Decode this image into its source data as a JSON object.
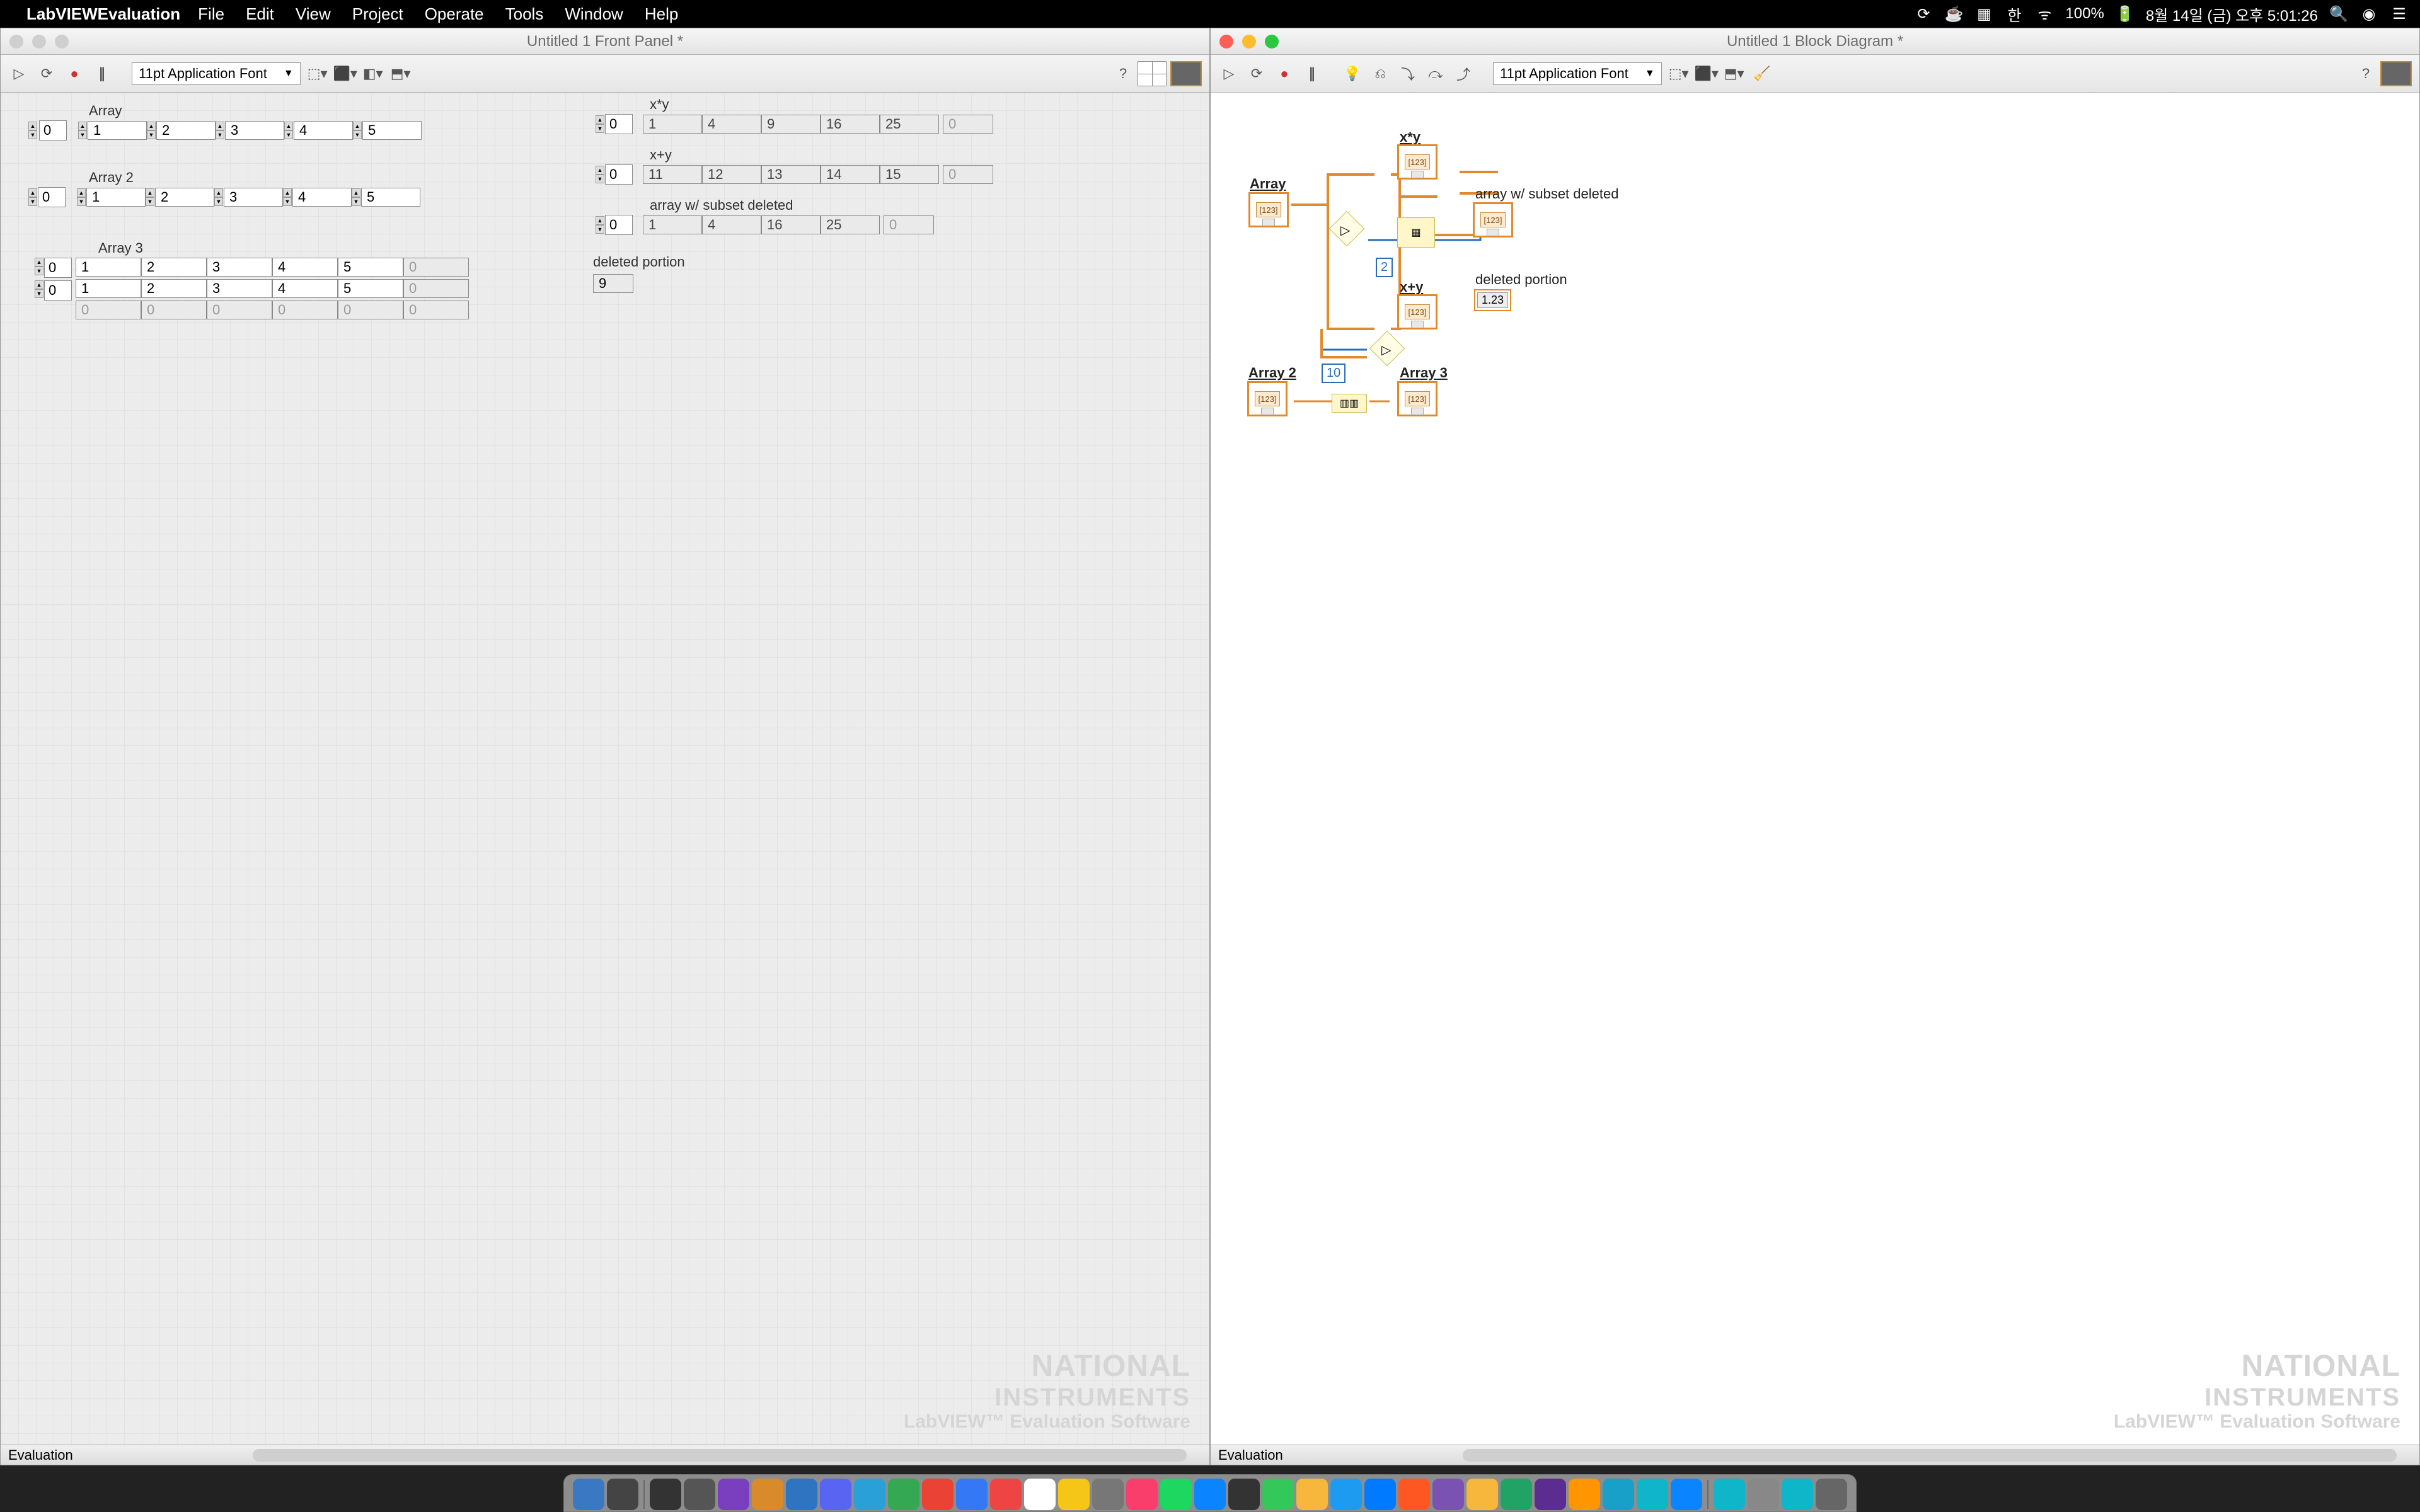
{
  "menubar": {
    "app": "LabVIEWEvaluation",
    "items": [
      "File",
      "Edit",
      "View",
      "Project",
      "Operate",
      "Tools",
      "Window",
      "Help"
    ],
    "status": {
      "battery": "100%",
      "date": "8월 14일 (금)  오후  5:01:26",
      "ime": "한"
    }
  },
  "windows": {
    "front_panel": {
      "title": "Untitled 1 Front Panel *",
      "font": "11pt Application Font",
      "status": "Evaluation"
    },
    "block_diagram": {
      "title": "Untitled 1 Block Diagram *",
      "font": "11pt Application Font",
      "status": "Evaluation"
    }
  },
  "front_panel": {
    "arrays": {
      "Array": {
        "label": "Array",
        "index": "0",
        "row": [
          "1",
          "2",
          "3",
          "4",
          "5"
        ]
      },
      "Array2": {
        "label": "Array 2",
        "index": "0",
        "row": [
          "1",
          "2",
          "3",
          "4",
          "5"
        ]
      },
      "Array3": {
        "label": "Array 3",
        "idx_r": "0",
        "idx_c": "0",
        "rows": [
          [
            "1",
            "2",
            "3",
            "4",
            "5",
            "0"
          ],
          [
            "1",
            "2",
            "3",
            "4",
            "5",
            "0"
          ],
          [
            "0",
            "0",
            "0",
            "0",
            "0",
            "0"
          ]
        ]
      }
    },
    "indicators": {
      "xtimesy": {
        "label": "x*y",
        "index": "0",
        "row": [
          "1",
          "4",
          "9",
          "16",
          "25"
        ],
        "extra": "0"
      },
      "xplusy": {
        "label": "x+y",
        "index": "0",
        "row": [
          "11",
          "12",
          "13",
          "14",
          "15"
        ],
        "extra": "0"
      },
      "subset": {
        "label": "array w/ subset deleted",
        "index": "0",
        "row": [
          "1",
          "4",
          "16",
          "25"
        ],
        "extra": "0"
      },
      "deleted": {
        "label": "deleted portion",
        "value": "9"
      }
    }
  },
  "block_diagram": {
    "labels": {
      "Array": "Array",
      "Array2": "Array 2",
      "Array3": "Array 3",
      "xty": "x*y",
      "xpy": "x+y",
      "subset": "array w/ subset deleted",
      "deleted": "deleted portion"
    },
    "constants": {
      "two": "2",
      "ten": "10"
    },
    "deleted_out": "1.23"
  },
  "watermark": {
    "l1": "NATIONAL",
    "l2": "INSTRUMENTS",
    "l3": "LabVIEW™ Evaluation Software"
  },
  "dock": {
    "count": 37
  }
}
